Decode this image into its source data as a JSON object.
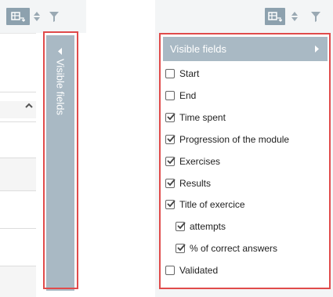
{
  "toolbar": {
    "buttons": [
      {
        "icon": "columns-icon",
        "active": true
      },
      {
        "icon": "sort-icon",
        "active": false
      },
      {
        "icon": "filter-icon",
        "active": false
      }
    ]
  },
  "collapsed_panel": {
    "label": "Visible fields"
  },
  "expanded_panel": {
    "header": "Visible fields",
    "fields": [
      {
        "label": "Start",
        "checked": false,
        "indent": false
      },
      {
        "label": "End",
        "checked": false,
        "indent": false
      },
      {
        "label": "Time spent",
        "checked": true,
        "indent": false
      },
      {
        "label": "Progression of the module",
        "checked": true,
        "indent": false
      },
      {
        "label": "Exercises",
        "checked": true,
        "indent": false
      },
      {
        "label": "Results",
        "checked": true,
        "indent": false
      },
      {
        "label": "Title of exercice",
        "checked": true,
        "indent": false
      },
      {
        "label": "attempts",
        "checked": true,
        "indent": true
      },
      {
        "label": "% of correct answers",
        "checked": true,
        "indent": true
      },
      {
        "label": "Validated",
        "checked": false,
        "indent": false
      }
    ]
  },
  "colors": {
    "accent": "#a9b9c4",
    "highlight_border": "#e04b4b",
    "toolbar_bg": "#f3f5f6"
  }
}
